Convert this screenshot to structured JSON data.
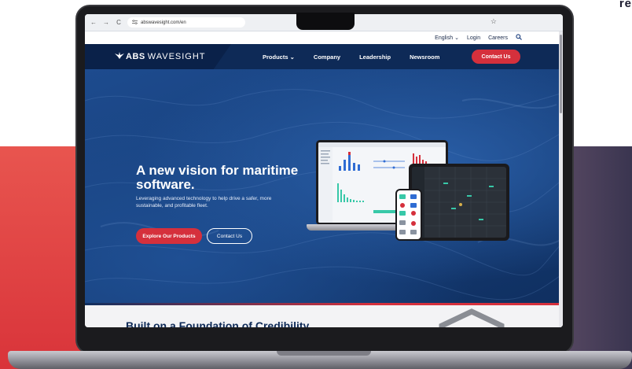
{
  "corner_text": "re",
  "browser": {
    "url": "abswavesight.com/en",
    "back": "←",
    "forward": "→",
    "reload": "C",
    "star": "☆"
  },
  "utility": {
    "language": "English",
    "login": "Login",
    "careers": "Careers"
  },
  "nav": {
    "logo_abs": "ABS",
    "logo_wavesight": "WAVESIGHT",
    "links": [
      "Products",
      "Company",
      "Leadership",
      "Newsroom"
    ],
    "contact": "Contact Us"
  },
  "hero": {
    "title": "A new vision for maritime software.",
    "subtitle": "Leveraging advanced technology to help drive a safer, more sustainable, and profitable fleet.",
    "primary_button": "Explore Our Products",
    "secondary_button": "Contact Us"
  },
  "lower": {
    "title": "Built on a Foundation of Credibility"
  },
  "colors": {
    "navy": "#0e2a57",
    "accent_red": "#d5303c",
    "hero_blue": "#1d4b8e"
  }
}
